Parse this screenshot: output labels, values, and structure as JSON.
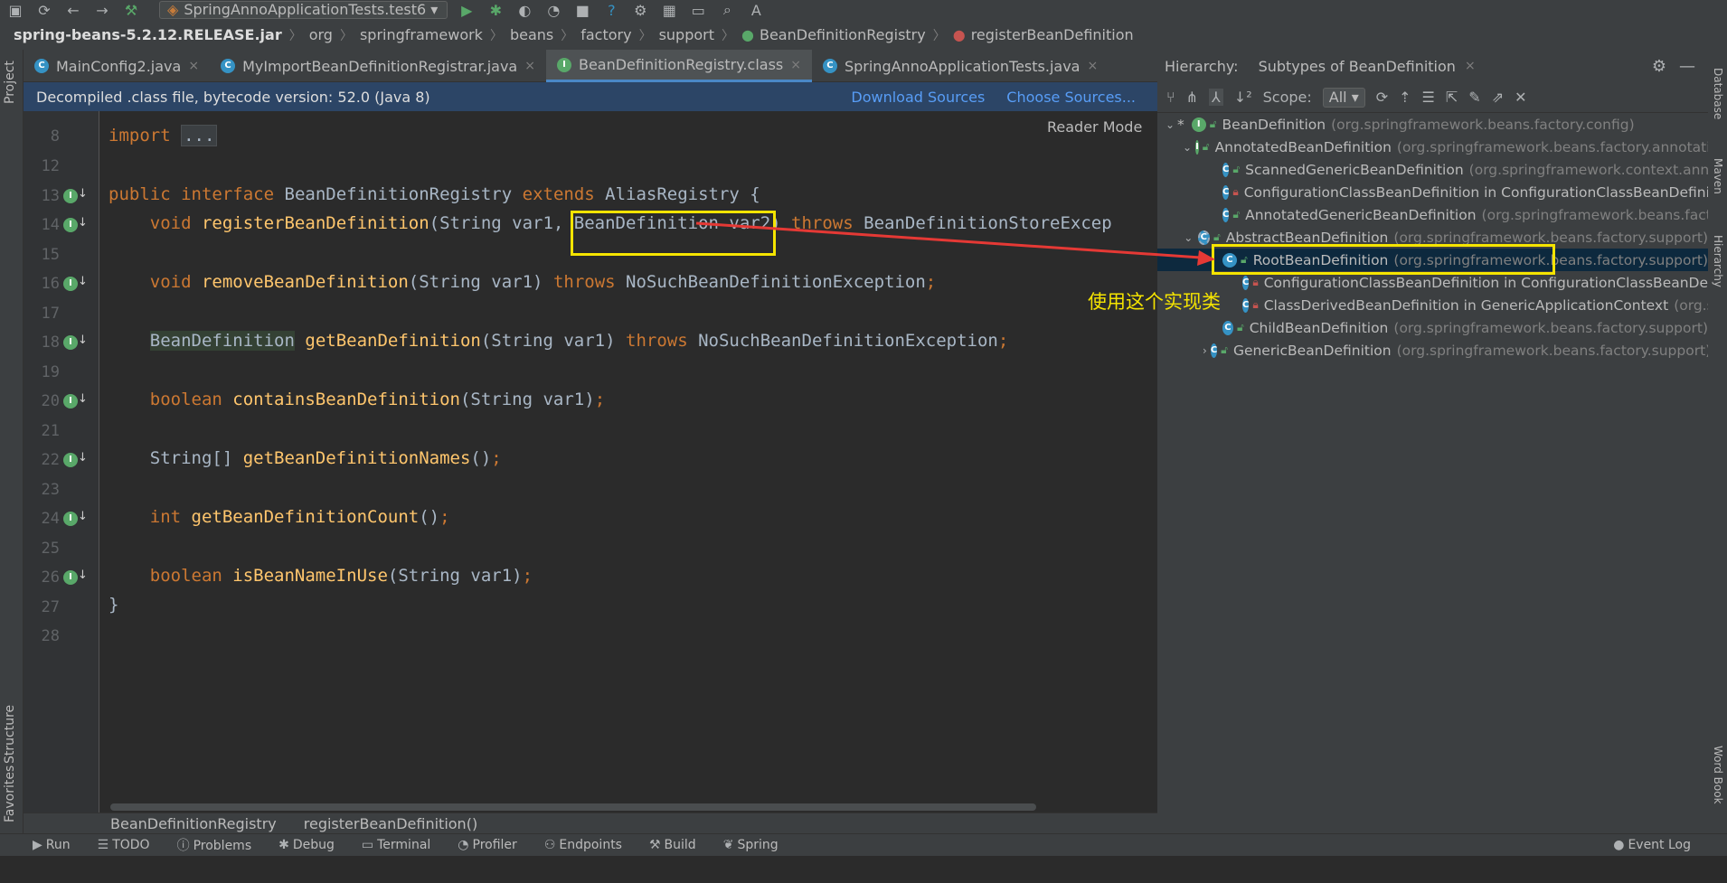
{
  "toolbar": {
    "run_config": "SpringAnnoApplicationTests.test6",
    "icons": [
      "save-icon",
      "back-icon",
      "forward-icon",
      "build-icon",
      "run-icon",
      "debug-icon",
      "coverage-icon",
      "profile-icon",
      "stop-icon",
      "help-icon",
      "settings-icon",
      "project-structure-icon",
      "search-icon",
      "translate-icon"
    ]
  },
  "breadcrumbs": {
    "jar": "spring-beans-5.2.12.RELEASE.jar",
    "items": [
      "org",
      "springframework",
      "beans",
      "factory",
      "support",
      "BeanDefinitionRegistry",
      "registerBeanDefinition"
    ]
  },
  "tabs": [
    {
      "label": "MainConfig2.java",
      "icon": "C"
    },
    {
      "label": "MyImportBeanDefinitionRegistrar.java",
      "icon": "C"
    },
    {
      "label": "BeanDefinitionRegistry.class",
      "icon": "I",
      "active": true
    },
    {
      "label": "SpringAnnoApplicationTests.java",
      "icon": "C"
    }
  ],
  "infobar": {
    "message": "Decompiled .class file, bytecode version: 52.0 (Java 8)",
    "download_sources": "Download Sources",
    "choose_sources": "Choose Sources..."
  },
  "editor": {
    "reader_mode": "Reader Mode",
    "lines": [
      {
        "n": "8"
      },
      {
        "n": "12"
      },
      {
        "n": "13"
      },
      {
        "n": "14"
      },
      {
        "n": "15"
      },
      {
        "n": "16"
      },
      {
        "n": "17"
      },
      {
        "n": "18"
      },
      {
        "n": "19"
      },
      {
        "n": "20"
      },
      {
        "n": "21"
      },
      {
        "n": "22"
      },
      {
        "n": "23"
      },
      {
        "n": "24"
      },
      {
        "n": "25"
      },
      {
        "n": "26"
      },
      {
        "n": "27"
      },
      {
        "n": "28"
      }
    ],
    "code": {
      "import_kw": "import",
      "import_fold": "...",
      "l13_public": "public",
      "l13_interface": "interface",
      "l13_name": "BeanDefinitionRegistry",
      "l13_extends": "extends",
      "l13_rest": "AliasRegistry {",
      "l14_void": "void",
      "l14_fn": "registerBeanDefinition",
      "l14_args": "(String var1, BeanDefinition var2)",
      "l14_throws": "throws",
      "l14_ex": "BeanDefinitionStoreExcep",
      "l16_void": "void",
      "l16_fn": "removeBeanDefinition",
      "l16_args": "(String var1)",
      "l16_throws": "throws",
      "l16_ex": "NoSuchBeanDefinitionException",
      "l18_type": "BeanDefinition",
      "l18_fn": "getBeanDefinition",
      "l18_args": "(String var1)",
      "l18_throws": "throws",
      "l18_ex": "NoSuchBeanDefinitionException",
      "l20_type": "boolean",
      "l20_fn": "containsBeanDefinition",
      "l20_args": "(String var1)",
      "l22_type": "String[]",
      "l22_fn": "getBeanDefinitionNames",
      "l22_args": "()",
      "l24_type": "int",
      "l24_fn": "getBeanDefinitionCount",
      "l24_args": "()",
      "l26_type": "boolean",
      "l26_fn": "isBeanNameInUse",
      "l26_args": "(String var1)",
      "l27": "}",
      "semi": ";"
    }
  },
  "statusbar": {
    "crumb1": "BeanDefinitionRegistry",
    "crumb2": "registerBeanDefinition()"
  },
  "hierarchy": {
    "title": "Hierarchy:",
    "tab": "Subtypes of BeanDefinition",
    "scope_label": "Scope:",
    "scope_value": "All",
    "tree": [
      {
        "name": "BeanDefinition",
        "pkg": "(org.springframework.beans.factory.config)"
      },
      {
        "name": "AnnotatedBeanDefinition",
        "pkg": "(org.springframework.beans.factory.annotatio"
      },
      {
        "name": "ScannedGenericBeanDefinition",
        "pkg": "(org.springframework.context.annot"
      },
      {
        "name": "ConfigurationClassBeanDefinition in ConfigurationClassBeanDefinitio",
        "pkg": ""
      },
      {
        "name": "AnnotatedGenericBeanDefinition",
        "pkg": "(org.springframework.beans.factor"
      },
      {
        "name": "AbstractBeanDefinition",
        "pkg": "(org.springframework.beans.factory.support)"
      },
      {
        "name": "RootBeanDefinition",
        "pkg": "(org.springframework.beans.factory.support)"
      },
      {
        "name": "ConfigurationClassBeanDefinition in ConfigurationClassBeanDefin",
        "pkg": ""
      },
      {
        "name": "ClassDerivedBeanDefinition in GenericApplicationContext",
        "pkg": "(org.sp"
      },
      {
        "name": "ChildBeanDefinition",
        "pkg": "(org.springframework.beans.factory.support)"
      },
      {
        "name": "GenericBeanDefinition",
        "pkg": "(org.springframework.beans.factory.support)"
      }
    ]
  },
  "annotation": {
    "text": "使用这个实现类"
  },
  "left_sidebar": {
    "project": "Project",
    "structure": "Structure",
    "favorites": "Favorites"
  },
  "right_sidebar": {
    "database": "Database",
    "maven": "Maven",
    "hierarchy": "Hierarchy",
    "word_book": "Word Book"
  },
  "bottombar": {
    "items": [
      "Run",
      "TODO",
      "Problems",
      "Debug",
      "Terminal",
      "Profiler",
      "Endpoints",
      "Build",
      "Spring"
    ],
    "event_log": "Event Log"
  }
}
